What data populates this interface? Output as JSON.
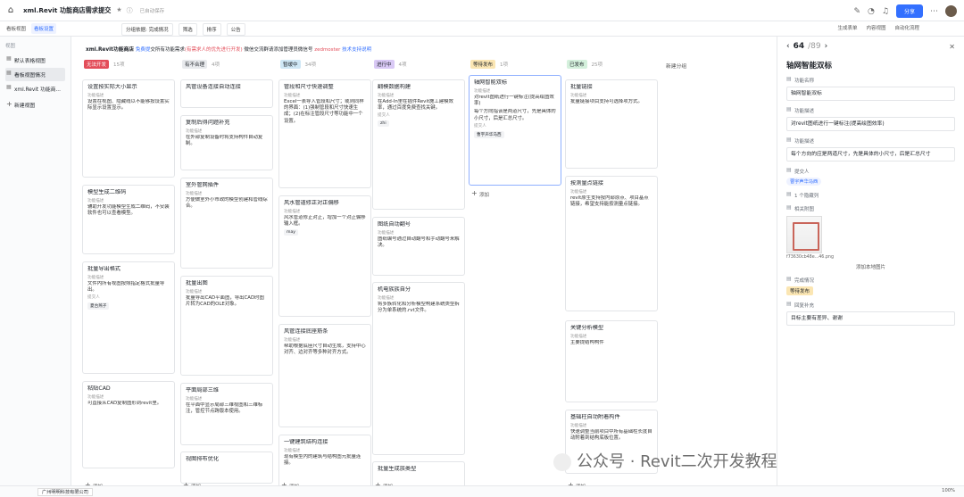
{
  "topbar": {
    "title": "xml.Revit 功能商店需求提交",
    "saved": "已自动保存",
    "share": "分享"
  },
  "toolbar": {
    "left": [
      "看板视图",
      "看板设置"
    ],
    "mid": [
      "分组依据: 完成情况",
      "筛选",
      "排序",
      "公告"
    ],
    "right": [
      "生成表单",
      "内容视图",
      "自动化流程"
    ]
  },
  "sidebar": {
    "header": "视图",
    "items": [
      "默认表格视图",
      "看板视图情况",
      "xml.Revit 功能商..."
    ],
    "new": "新建视图"
  },
  "info": {
    "title": "xml.Revit功能商店",
    "p1": "免费提",
    "p2": "交所有功能需求",
    "req": "(有需求人的优先进行开发)",
    "tail": "微信交流群请添加管理员微信号",
    "wx": "zedmoster",
    "link": "技术支持说明"
  },
  "columns": [
    {
      "name": "无法开发",
      "count": "15项",
      "color": "#e34d59",
      "tc": "#fff",
      "add": "添加",
      "cards": [
        {
          "t": "设置按实际大小显示",
          "l1": "功能描述",
          "v1": "设置在视图、隐藏线以不能够按设置实际显示设置显示。",
          "l2": "",
          "v2": ""
        },
        {
          "t": "模型生成二维码",
          "l1": "功能描述",
          "v1": "辅助开发功能模型生成二维码，不安装软件也可以查看模型。",
          "l2": "",
          "v2": ""
        },
        {
          "t": "批量导出格式",
          "l1": "功能描述",
          "v1": "文件内所有视图按照指定格式批量导出。",
          "l2": "提交人",
          "v2": "",
          "chip": "夏台燕子"
        },
        {
          "t": "粘贴CAD",
          "l1": "功能描述",
          "v1": "可直接从CAD复制图形到revit里。",
          "l2": "",
          "v2": ""
        }
      ]
    },
    {
      "name": "有不合理",
      "count": "4项",
      "color": "#e8eaed",
      "tc": "#1f2329",
      "add": "添加",
      "cards": [
        {
          "t": "风管设备连接自动连接",
          "l1": "",
          "v1": "",
          "l2": "",
          "v2": ""
        },
        {
          "t": "复制后得问题补充",
          "l1": "功能描述",
          "v1": "在外部复制设备时将支持构件自动复制。",
          "l2": "",
          "v2": ""
        },
        {
          "t": "室外管网插件",
          "l1": "功能描述",
          "v1": "方便做室外小市政的模型创建和管线综合。",
          "l2": "",
          "v2": ""
        },
        {
          "t": "批量出图",
          "l1": "功能描述",
          "v1": "批量导出CAD平面图，导出CAD时图片转为CAD的OLE对象。",
          "l2": "",
          "v2": ""
        },
        {
          "t": "平面局部三维",
          "l1": "功能描述",
          "v1": "在平面中显示局部三维视图和三维标注，管控节点跨版本使用。",
          "l2": "",
          "v2": ""
        },
        {
          "t": "视图排布优化",
          "l1": "",
          "v1": "",
          "l2": "",
          "v2": ""
        }
      ]
    },
    {
      "name": "暂缓中",
      "count": "34项",
      "color": "#cfe7f5",
      "tc": "#1f2329",
      "add": "添加",
      "cards": [
        {
          "t": "管段和尺寸快速调整",
          "l1": "功能描述",
          "v1": "Excel一表导入管段和尺寸；或则同样的界面：(1)强制管段和尺寸快速生成；(2)在标注管段尺寸等功能中一个设置。",
          "l2": "",
          "v2": ""
        },
        {
          "t": "风水管道修正对正偏移",
          "l1": "功能描述",
          "v1": "风水管道修正对正，增加一个对正偏移输入框。",
          "l2": "",
          "v2": "",
          "chip": "may"
        },
        {
          "t": "风管连接底座筋条",
          "l1": "功能描述",
          "v1": "帮助根据底座尺寸自动生成，支持中心对齐、边对齐等多种对齐方式。",
          "l2": "",
          "v2": ""
        },
        {
          "t": "一键建筑结构连接",
          "l1": "功能描述",
          "v1": "现有模型内的建筑与结构图元批量连接。",
          "l2": "",
          "v2": ""
        }
      ]
    },
    {
      "name": "进行中",
      "count": "4项",
      "color": "#d9c9f5",
      "tc": "#1f2329",
      "add": "添加",
      "cards": [
        {
          "t": "翻模数据构建",
          "l1": "功能描述",
          "v1": "在Add-In里在插件Revit施工建模效率，通过百度免费查找关键。",
          "l2": "提交人",
          "v2": "",
          "chip": "zhi"
        },
        {
          "t": "图纸自动翻号",
          "l1": "功能描述",
          "v1": "图纸编号通过自动翻号和手动翻号来解决。",
          "l2": "",
          "v2": ""
        },
        {
          "t": "机电族族自分",
          "l1": "功能描述",
          "v1": "将多族转化和分析模型构建系统类型拆分为单系统的.rvt文件。",
          "l2": "",
          "v2": ""
        },
        {
          "t": "批量生成族类型",
          "l1": "",
          "v1": "",
          "l2": "",
          "v2": ""
        }
      ]
    },
    {
      "name": "等待发布",
      "count": "1项",
      "color": "#fbe6b3",
      "tc": "#1f2329",
      "add": "添加",
      "cards": [
        {
          "t": "轴网智能双标",
          "l1": "功能描述",
          "v1": "对revit图纸进行一键标注(提高绘图效率)",
          "l2": "提交人",
          "v2": "",
          "chip": "曹宇声华马西",
          "l3": "",
          "v3": "每个方向指该是两道尺寸，先是具体的小尺寸，后是汇总尺寸。"
        }
      ]
    },
    {
      "name": "已发布",
      "count": "25项",
      "color": "#d4f0dc",
      "tc": "#1f2329",
      "add": "添加",
      "cards": [
        {
          "t": "批量链接",
          "l1": "功能描述",
          "v1": "批量链接项目支持可选择项方式。",
          "l2": "",
          "v2": ""
        },
        {
          "t": "按测量点链接",
          "l1": "功能描述",
          "v1": "revit原生支持按内部原点、项目基点链接，希望支持能按测量点链接。",
          "l2": "",
          "v2": ""
        },
        {
          "t": "关键分析模型",
          "l1": "功能描述",
          "v1": "主要提结构构件",
          "l2": "",
          "v2": ""
        },
        {
          "t": "基础柱自动附着构件",
          "l1": "功能描述",
          "v1": "快速调整当前项目中所有基础柱长度自动附着到结构底板位置。",
          "l2": "",
          "v2": ""
        }
      ]
    }
  ],
  "newgroup": "新建分组",
  "panel": {
    "index": "64",
    "total": "/89",
    "title": "轴网智能双标",
    "f1": "功能名称",
    "v1": "轴网智能双标",
    "f2": "功能描述",
    "v2": "对revit图纸进行一键标注(提高绘图效率)",
    "f3": "功能描述",
    "v3": "每个方向的应是两道尺寸，先是具体的小尺寸，后是汇总尺寸",
    "f4": "提交人",
    "chip4": "曹宇声华马西",
    "f5": "1 个隐藏列",
    "f6": "相关附图",
    "file": "f73630cb48e...46.png",
    "addimg": "添加本地图片",
    "f7": "完成情况",
    "status": "等待发布",
    "f8": "回复补充",
    "v8": "目标主要有差异、谢谢"
  },
  "status": {
    "org": "广州明明科技有限公司",
    "zoom": "100%"
  },
  "watermark": "公众号 · Revit二次开发教程"
}
